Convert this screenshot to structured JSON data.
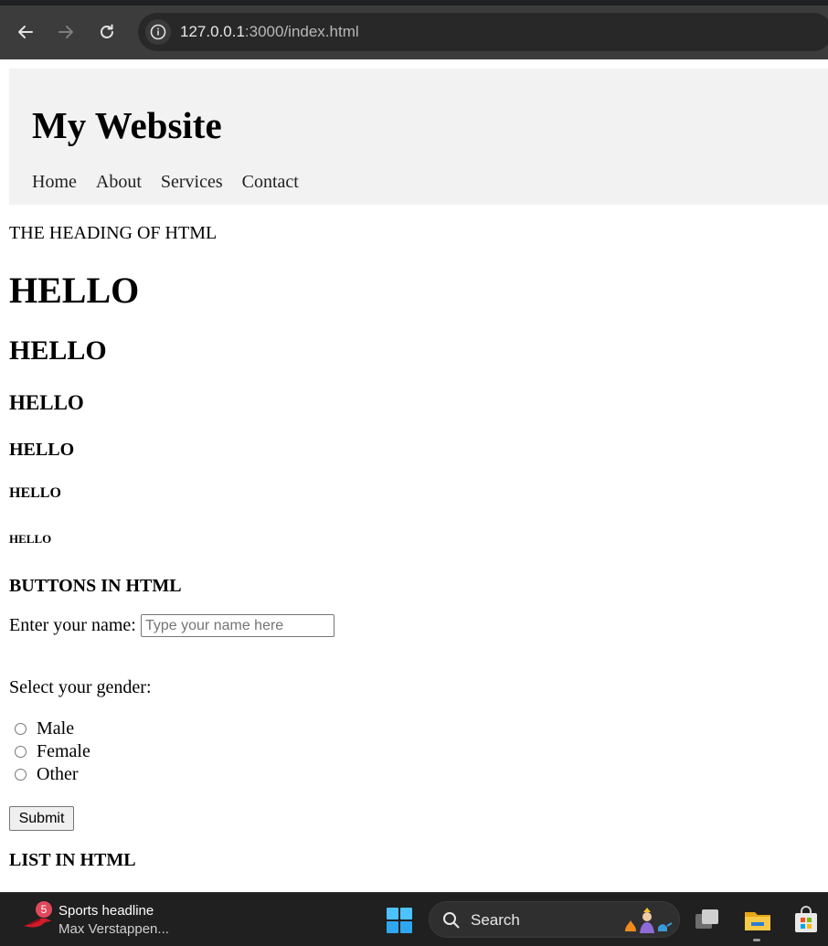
{
  "browser": {
    "url_host": "127.0.0.1",
    "url_rest": ":3000/index.html"
  },
  "site": {
    "title": "My Website",
    "nav": [
      "Home",
      "About",
      "Services",
      "Contact"
    ]
  },
  "content": {
    "intro": "THE HEADING OF HTML",
    "h1": "HELLO",
    "h2": "HELLO",
    "h3": "HELLO",
    "h4": "HELLO",
    "h5": "HELLO",
    "h6": "HELLO",
    "buttons_heading": "BUTTONS IN HTML",
    "name_label": "Enter your name:",
    "name_placeholder": "Type your name here",
    "gender_label": "Select your gender:",
    "gender_options": [
      "Male",
      "Female",
      "Other"
    ],
    "submit_label": "Submit",
    "list_heading": "LIST IN HTML"
  },
  "taskbar": {
    "news_badge": "5",
    "news_title": "Sports headline",
    "news_subtitle": "Max Verstappen...",
    "search_label": "Search"
  }
}
